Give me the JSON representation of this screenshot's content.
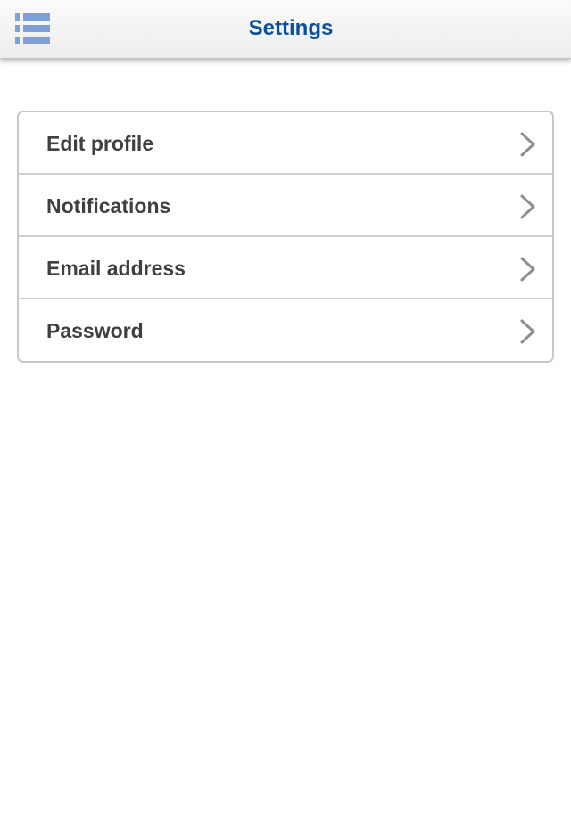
{
  "header": {
    "title": "Settings",
    "menu_icon": "list-menu-icon"
  },
  "settings": {
    "items": [
      {
        "label": "Edit profile",
        "icon": "chevron-right-icon"
      },
      {
        "label": "Notifications",
        "icon": "chevron-right-icon"
      },
      {
        "label": "Email address",
        "icon": "chevron-right-icon"
      },
      {
        "label": "Password",
        "icon": "chevron-right-icon"
      }
    ]
  },
  "colors": {
    "title": "#0b4f9e",
    "menu_icon": "#7f9fd8",
    "item_text": "#404043",
    "border": "#c9c9cd",
    "chevron": "#8e8e93"
  }
}
